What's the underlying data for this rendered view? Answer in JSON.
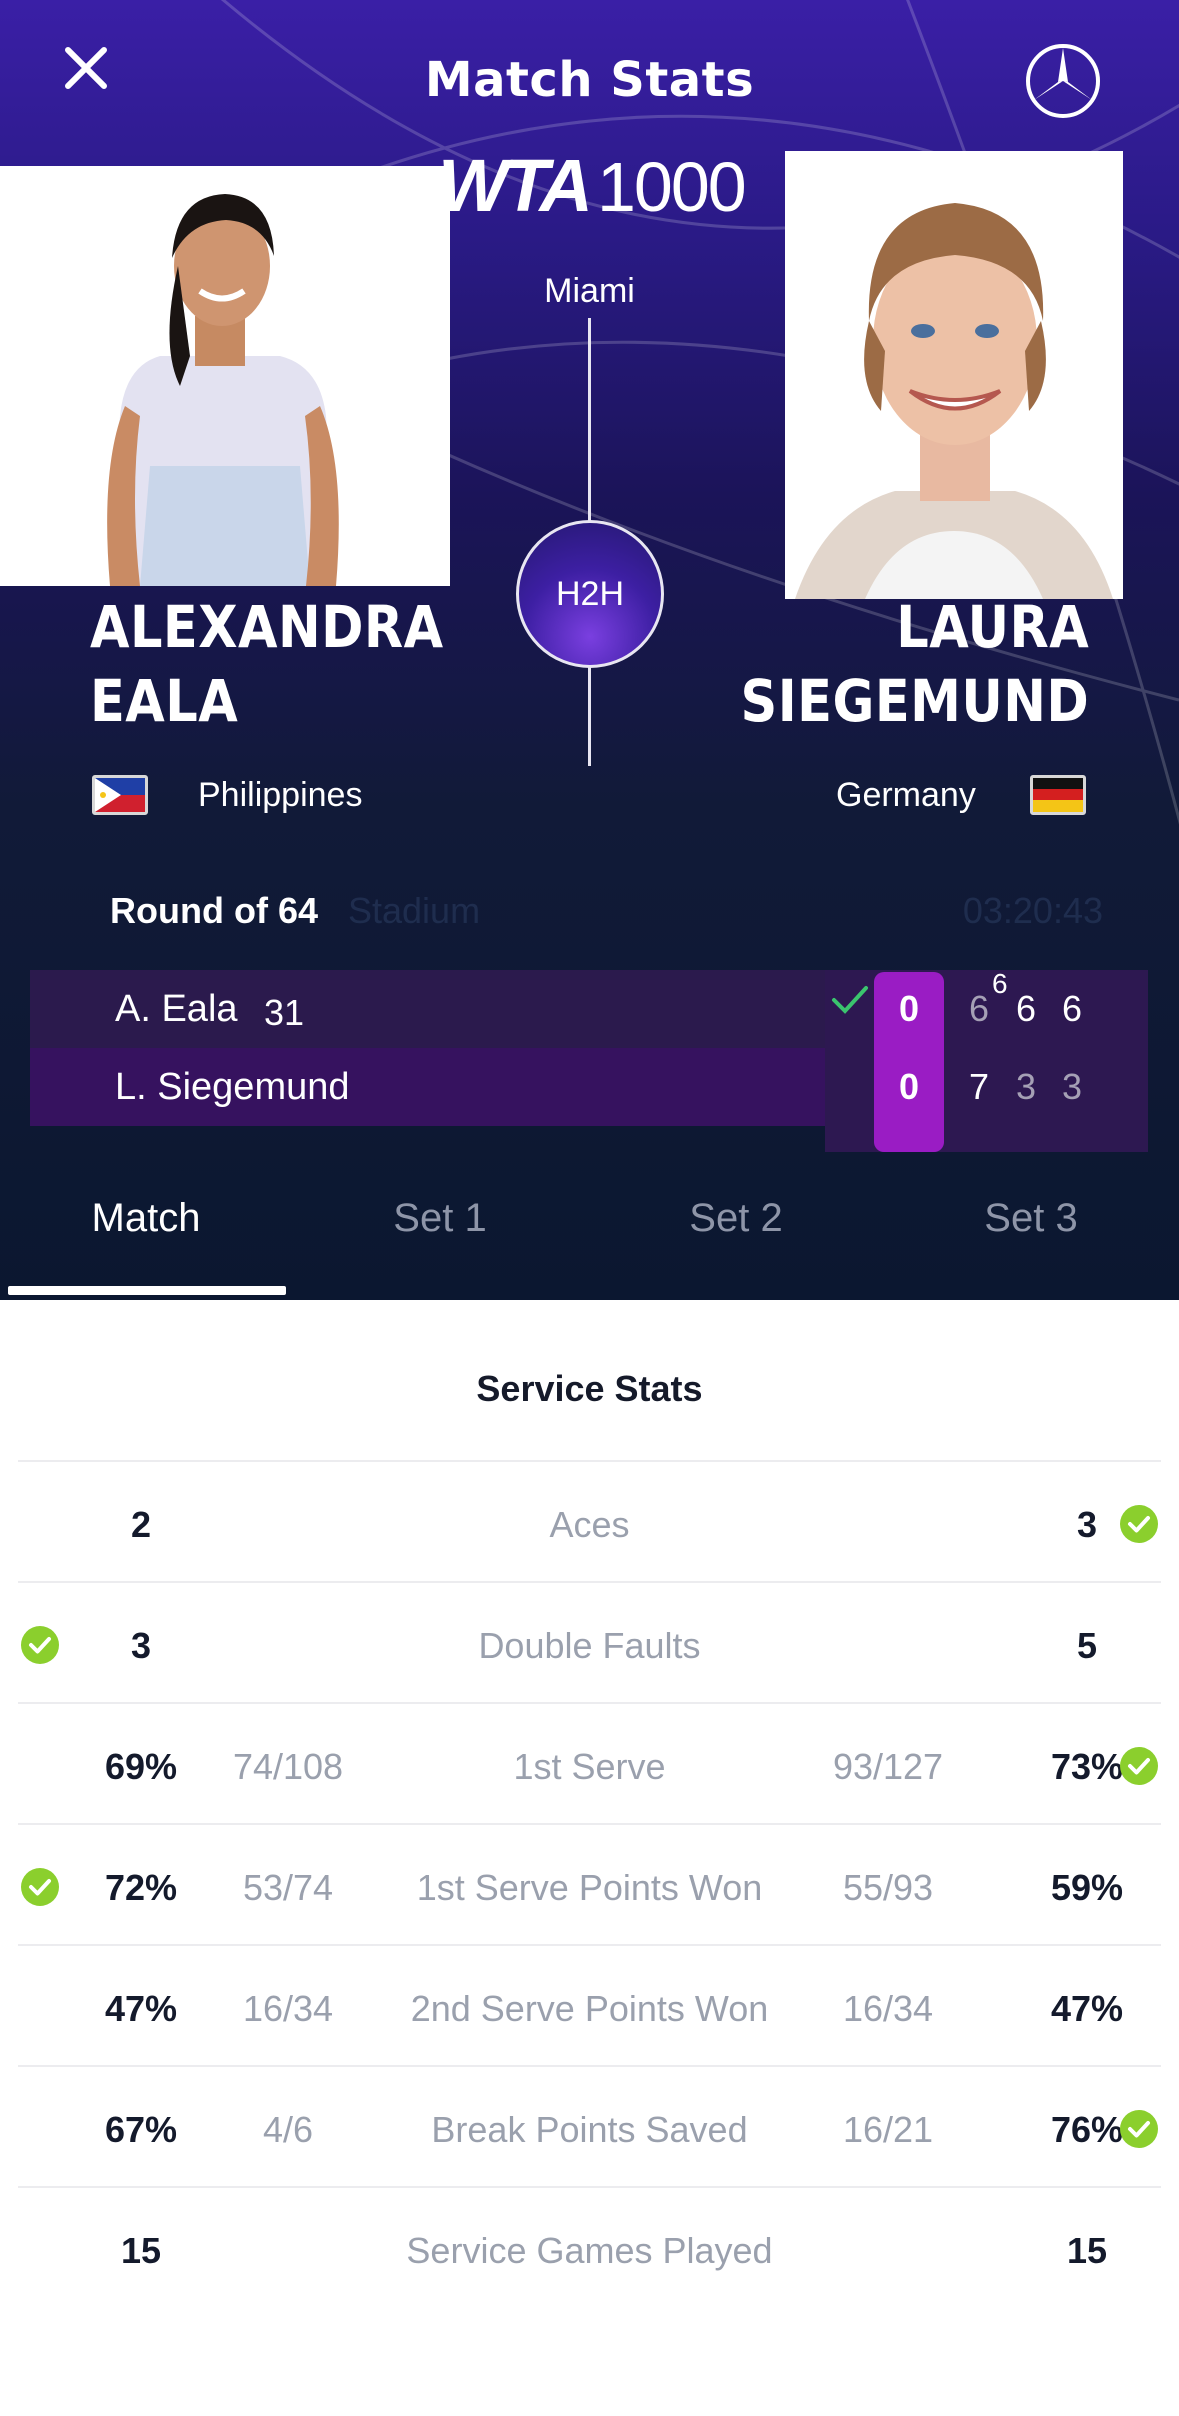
{
  "header": {
    "title": "Match Stats",
    "tournament_logo_text": "WTA",
    "tournament_level": "1000",
    "city": "Miami",
    "h2h_label": "H2H"
  },
  "players": {
    "left": {
      "first": "ALEXANDRA",
      "last": "EALA",
      "country": "Philippines"
    },
    "right": {
      "first": "LAURA",
      "last": "SIEGEMUND",
      "country": "Germany"
    }
  },
  "match": {
    "round": "Round of 64",
    "court": "Stadium",
    "duration": "03:20:43"
  },
  "scoreboard": {
    "p1": {
      "name": "A. Eala",
      "seed": "31",
      "current": "0",
      "sets": [
        "6",
        "6",
        "6"
      ],
      "tiebreak": "6"
    },
    "p2": {
      "name": "L. Siegemund",
      "current": "0",
      "sets": [
        "7",
        "3",
        "3"
      ]
    }
  },
  "tabs": [
    "Match",
    "Set 1",
    "Set 2",
    "Set 3"
  ],
  "active_tab": "Match",
  "stats": {
    "section_title": "Service Stats",
    "rows": [
      {
        "label": "Aces",
        "left": "2",
        "right": "3",
        "left_frac": "",
        "right_frac": "",
        "leader": "right"
      },
      {
        "label": "Double Faults",
        "left": "3",
        "right": "5",
        "left_frac": "",
        "right_frac": "",
        "leader": "left"
      },
      {
        "label": "1st Serve",
        "left": "69%",
        "right": "73%",
        "left_frac": "74/108",
        "right_frac": "93/127",
        "leader": "right"
      },
      {
        "label": "1st Serve Points Won",
        "left": "72%",
        "right": "59%",
        "left_frac": "53/74",
        "right_frac": "55/93",
        "leader": "left"
      },
      {
        "label": "2nd Serve Points Won",
        "left": "47%",
        "right": "47%",
        "left_frac": "16/34",
        "right_frac": "16/34",
        "leader": "none"
      },
      {
        "label": "Break Points Saved",
        "left": "67%",
        "right": "76%",
        "left_frac": "4/6",
        "right_frac": "16/21",
        "leader": "right"
      },
      {
        "label": "Service Games Played",
        "left": "15",
        "right": "15",
        "left_frac": "",
        "right_frac": "",
        "leader": "none"
      }
    ]
  },
  "colors": {
    "hero_top": "#3a1fa6",
    "hero_bottom": "#0b1730",
    "current_game_highlight": "#9a1cc4",
    "leader_check": "#8bcf2d"
  }
}
